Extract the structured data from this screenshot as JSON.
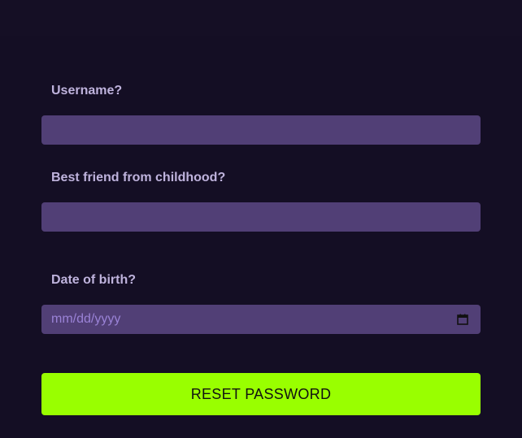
{
  "form": {
    "username": {
      "label": "Username?",
      "value": "",
      "placeholder": ""
    },
    "best_friend": {
      "label": "Best friend from childhood?",
      "value": "",
      "placeholder": ""
    },
    "dob": {
      "label": "Date of birth?",
      "placeholder": "mm/dd/yyyy",
      "icon": "calendar-icon"
    },
    "submit_label": "RESET PASSWORD"
  },
  "colors": {
    "background": "#140f24",
    "field": "#513f76",
    "label": "#bfb3dd",
    "accent": "#99ff00"
  }
}
